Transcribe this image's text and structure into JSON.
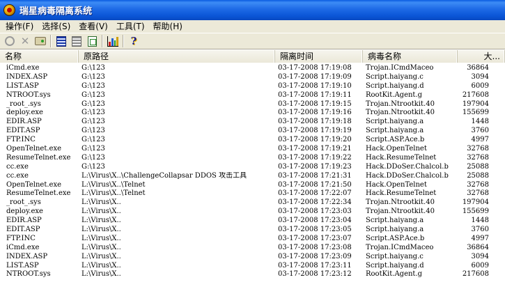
{
  "window": {
    "title": "瑞星病毒隔离系统"
  },
  "menu": [
    {
      "label": "操作(F)"
    },
    {
      "label": "选择(S)"
    },
    {
      "label": "查看(V)"
    },
    {
      "label": "工具(T)"
    },
    {
      "label": "帮助(H)"
    }
  ],
  "toolbar": {
    "buttons": [
      {
        "icon": "restore-icon"
      },
      {
        "icon": "delete-icon"
      },
      {
        "icon": "scan-icon"
      },
      {
        "icon": "details-view-icon"
      },
      {
        "icon": "list-view-icon"
      },
      {
        "icon": "export-icon"
      },
      {
        "icon": "statistics-icon"
      },
      {
        "icon": "help-icon"
      }
    ]
  },
  "columns": {
    "name": "名称",
    "path": "原路径",
    "time": "隔离时间",
    "virus": "病毒名称",
    "size": "大..."
  },
  "rows": [
    {
      "name": "iCmd.exe",
      "path": "G:\\123",
      "time": "03-17-2008 17:19:08",
      "virus": "Trojan.ICmdMaceo",
      "size": "36864"
    },
    {
      "name": "INDEX.ASP",
      "path": "G:\\123",
      "time": "03-17-2008 17:19:09",
      "virus": "Script.haiyang.c",
      "size": "3094"
    },
    {
      "name": "LIST.ASP",
      "path": "G:\\123",
      "time": "03-17-2008 17:19:10",
      "virus": "Script.haiyang.d",
      "size": "6009"
    },
    {
      "name": "NTROOT.sys",
      "path": "G:\\123",
      "time": "03-17-2008 17:19:11",
      "virus": "RootKit.Agent.g",
      "size": "217608"
    },
    {
      "name": "_root_.sys",
      "path": "G:\\123",
      "time": "03-17-2008 17:19:15",
      "virus": "Trojan.Ntrootkit.40",
      "size": "197904"
    },
    {
      "name": "deploy.exe",
      "path": "G:\\123",
      "time": "03-17-2008 17:19:16",
      "virus": "Trojan.Ntrootkit.40",
      "size": "155699"
    },
    {
      "name": "EDIR.ASP",
      "path": "G:\\123",
      "time": "03-17-2008 17:19:18",
      "virus": "Script.haiyang.a",
      "size": "1448"
    },
    {
      "name": "EDIT.ASP",
      "path": "G:\\123",
      "time": "03-17-2008 17:19:19",
      "virus": "Script.haiyang.a",
      "size": "3760"
    },
    {
      "name": "FTP.INC",
      "path": "G:\\123",
      "time": "03-17-2008 17:19:20",
      "virus": "Script.ASP.Ace.b",
      "size": "4997"
    },
    {
      "name": "OpenTelnet.exe",
      "path": "G:\\123",
      "time": "03-17-2008 17:19:21",
      "virus": "Hack.OpenTelnet",
      "size": "32768"
    },
    {
      "name": "ResumeTelnet.exe",
      "path": "G:\\123",
      "time": "03-17-2008 17:19:22",
      "virus": "Hack.ResumeTelnet",
      "size": "32768"
    },
    {
      "name": "cc.exe",
      "path": "G:\\123",
      "time": "03-17-2008 17:19:23",
      "virus": "Hack.DDoSer.Chalcol.b",
      "size": "25088"
    },
    {
      "name": "cc.exe",
      "path": "L:\\Virus\\X..\\ChallengeCollapsar DDOS 攻击工具",
      "time": "03-17-2008 17:21:31",
      "virus": "Hack.DDoSer.Chalcol.b",
      "size": "25088"
    },
    {
      "name": "OpenTelnet.exe",
      "path": "L:\\Virus\\X..\\Telnet",
      "time": "03-17-2008 17:21:50",
      "virus": "Hack.OpenTelnet",
      "size": "32768"
    },
    {
      "name": "ResumeTelnet.exe",
      "path": "L:\\Virus\\X..\\Telnet",
      "time": "03-17-2008 17:22:07",
      "virus": "Hack.ResumeTelnet",
      "size": "32768"
    },
    {
      "name": "_root_.sys",
      "path": "L:\\Virus\\X..",
      "time": "03-17-2008 17:22:34",
      "virus": "Trojan.Ntrootkit.40",
      "size": "197904"
    },
    {
      "name": "deploy.exe",
      "path": "L:\\Virus\\X..",
      "time": "03-17-2008 17:23:03",
      "virus": "Trojan.Ntrootkit.40",
      "size": "155699"
    },
    {
      "name": "EDIR.ASP",
      "path": "L:\\Virus\\X..",
      "time": "03-17-2008 17:23:04",
      "virus": "Script.haiyang.a",
      "size": "1448"
    },
    {
      "name": "EDIT.ASP",
      "path": "L:\\Virus\\X..",
      "time": "03-17-2008 17:23:05",
      "virus": "Script.haiyang.a",
      "size": "3760"
    },
    {
      "name": "FTP.INC",
      "path": "L:\\Virus\\X..",
      "time": "03-17-2008 17:23:07",
      "virus": "Script.ASP.Ace.b",
      "size": "4997"
    },
    {
      "name": "iCmd.exe",
      "path": "L:\\Virus\\X..",
      "time": "03-17-2008 17:23:08",
      "virus": "Trojan.ICmdMaceo",
      "size": "36864"
    },
    {
      "name": "INDEX.ASP",
      "path": "L:\\Virus\\X..",
      "time": "03-17-2008 17:23:09",
      "virus": "Script.haiyang.c",
      "size": "3094"
    },
    {
      "name": "LIST.ASP",
      "path": "L:\\Virus\\X..",
      "time": "03-17-2008 17:23:11",
      "virus": "Script.haiyang.d",
      "size": "6009"
    },
    {
      "name": "NTROOT.sys",
      "path": "L:\\Virus\\X..",
      "time": "03-17-2008 17:23:12",
      "virus": "RootKit.Agent.g",
      "size": "217608"
    }
  ]
}
